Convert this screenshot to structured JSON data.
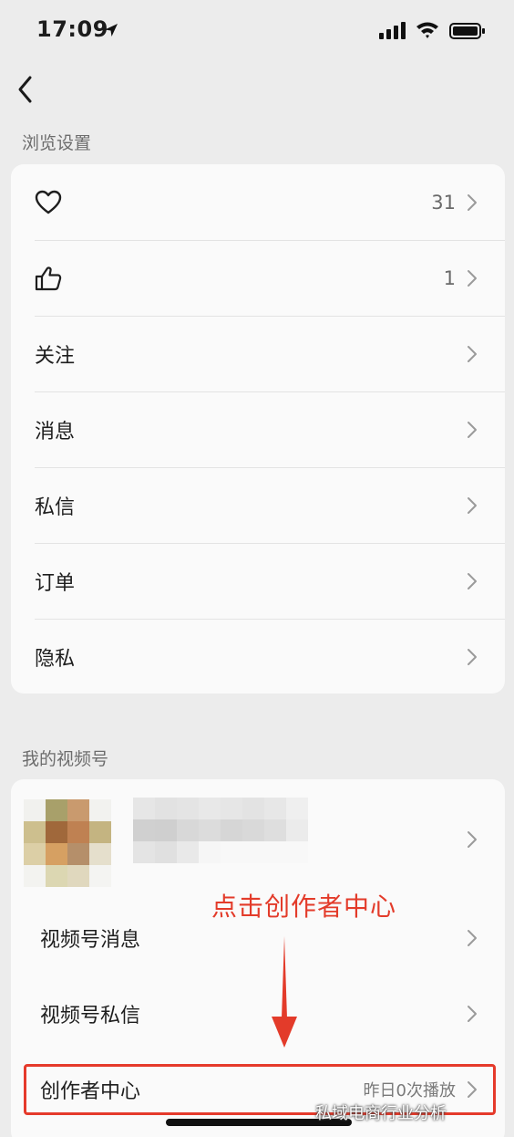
{
  "status": {
    "time": "17:09"
  },
  "browse": {
    "section_title": "浏览设置",
    "items": [
      {
        "icon": "heart-icon",
        "label": "",
        "count": "31"
      },
      {
        "icon": "thumbs-up-icon",
        "label": "",
        "count": "1"
      },
      {
        "label": "关注",
        "count": ""
      },
      {
        "label": "消息",
        "count": ""
      },
      {
        "label": "私信",
        "count": ""
      },
      {
        "label": "订单",
        "count": ""
      },
      {
        "label": "隐私",
        "count": ""
      }
    ]
  },
  "channels": {
    "section_title": "我的视频号",
    "items": [
      {
        "label": "视频号消息"
      },
      {
        "label": "视频号私信"
      },
      {
        "label": "创作者中心",
        "detail": "昨日0次播放"
      }
    ]
  },
  "annotation": {
    "text": "点击创作者中心",
    "color": "#e33b2a"
  },
  "watermark": {
    "text": "私域电商行业分析"
  }
}
